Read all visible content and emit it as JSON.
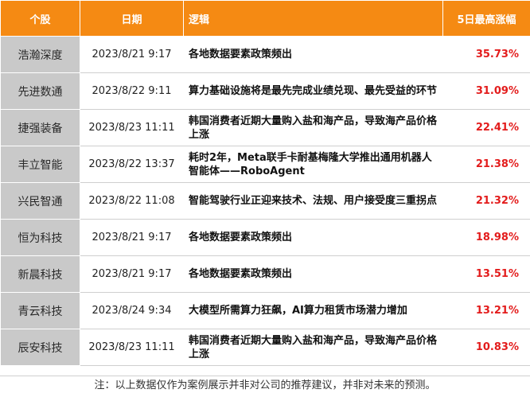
{
  "header": {
    "stock": "个股",
    "date": "日期",
    "logic": "逻辑",
    "gain": "5日最高涨幅"
  },
  "rows": [
    {
      "stock": "浩瀚深度",
      "date": "2023/8/21 9:17",
      "logic": "各地数据要素政策频出",
      "gain": "35.73%"
    },
    {
      "stock": "先进数通",
      "date": "2023/8/22 9:11",
      "logic": "算力基础设施将是最先完成业绩兑现、最先受益的环节",
      "gain": "31.09%"
    },
    {
      "stock": "捷强装备",
      "date": "2023/8/23 11:11",
      "logic": "韩国消费者近期大量购入盐和海产品，导致海产品价格上涨",
      "gain": "22.41%"
    },
    {
      "stock": "丰立智能",
      "date": "2023/8/22 13:37",
      "logic": "耗时2年，Meta联手卡耐基梅隆大学推出通用机器人智能体——RoboAgent",
      "gain": "21.38%"
    },
    {
      "stock": "兴民智通",
      "date": "2023/8/22 11:08",
      "logic": "智能驾驶行业正迎来技术、法规、用户接受度三重拐点",
      "gain": "21.32%"
    },
    {
      "stock": "恒为科技",
      "date": "2023/8/21 9:17",
      "logic": "各地数据要素政策频出",
      "gain": "18.98%"
    },
    {
      "stock": "新晨科技",
      "date": "2023/8/21 9:17",
      "logic": "各地数据要素政策频出",
      "gain": "13.51%"
    },
    {
      "stock": "青云科技",
      "date": "2023/8/24 9:34",
      "logic": "大模型所需算力狂飙，AI算力租赁市场潜力增加",
      "gain": "13.21%"
    },
    {
      "stock": "辰安科技",
      "date": "2023/8/23 11:11",
      "logic": "韩国消费者近期大量购入盐和海产品，导致海产品价格上涨",
      "gain": "10.83%"
    }
  ],
  "footer_note": "注：以上数据仅作为案例展示并非对公司的推荐建议，并非对未来的预测。",
  "colors": {
    "header_bg": "#f58a13",
    "stock_bg": "#c9c9c9",
    "gain_text": "#e31c1c"
  }
}
